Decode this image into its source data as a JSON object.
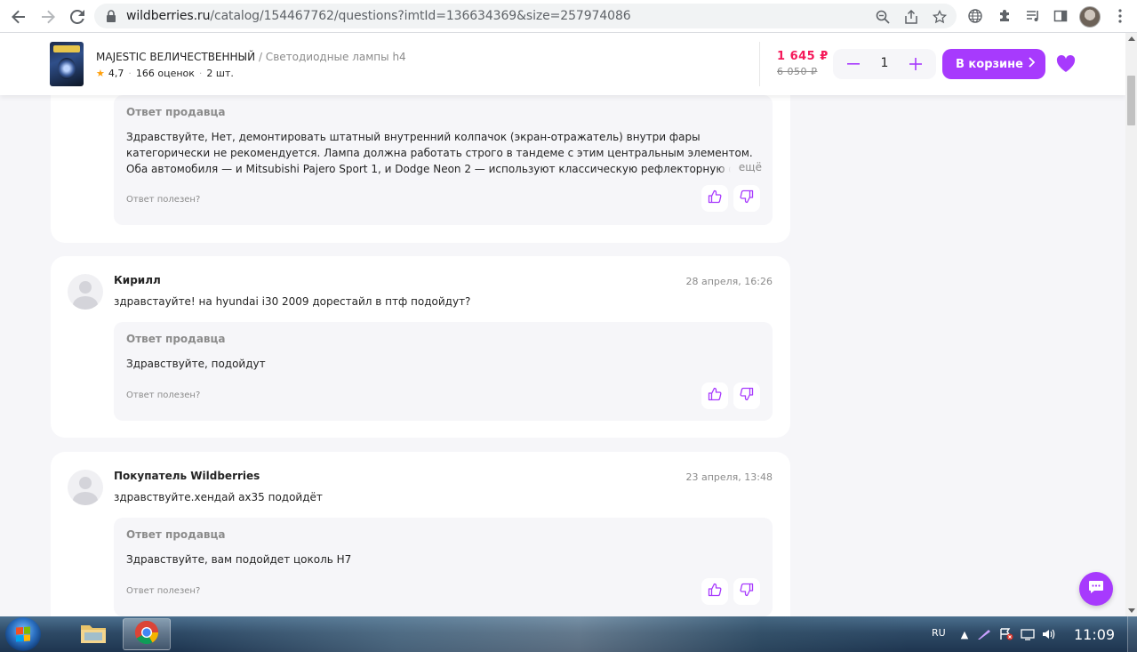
{
  "browser": {
    "url_domain": "wildberries.ru",
    "url_path": "/catalog/154467762/questions?imtId=136634369&size=257974086"
  },
  "product": {
    "title": "MAJESTIC ВЕЛИЧЕСТВЕННЫЙ",
    "category": "/ Светодиодные лампы h4",
    "rating": "4,7",
    "reviews": "166 оценок",
    "count": "2 шт.",
    "price": "1 645 ₽",
    "old_price": "6 050 ₽",
    "quantity": "1",
    "cart_label": "В корзине"
  },
  "questions": [
    {
      "answer_label": "Ответ продавца",
      "answer_text": "Здравствуйте, Нет, демонтировать штатный внутренний колпачок (экран-отражатель) внутри фары категорически не рекомендуется. Лампа должна работать строго в тандеме с этим центральным элементом. Оба автомобиля — и Mitsubishi Pajero Sport 1, и Dodge Neon 2 — используют классическую рефлекторную оп",
      "more_label": "ещё",
      "helpful_label": "Ответ полезен?"
    },
    {
      "author": "Кирилл",
      "date": "28 апреля, 16:26",
      "text": "здравстауйте! на hyundai i30 2009 дорестайл в птф подойдут?",
      "answer_label": "Ответ продавца",
      "answer_text": "Здравствуйте, подойдут",
      "helpful_label": "Ответ полезен?"
    },
    {
      "author": "Покупатель Wildberries",
      "date": "23 апреля, 13:48",
      "text": "здравствуйте.хендай ах35 подойдёт",
      "answer_label": "Ответ продавца",
      "answer_text": "Здравствуйте, вам подойдет цоколь H7",
      "helpful_label": "Ответ полезен?"
    }
  ],
  "taskbar": {
    "language": "RU",
    "time": "11:09"
  },
  "colors": {
    "accent": "#a73afd",
    "price": "#f5195a",
    "background": "#f6f6f9"
  }
}
